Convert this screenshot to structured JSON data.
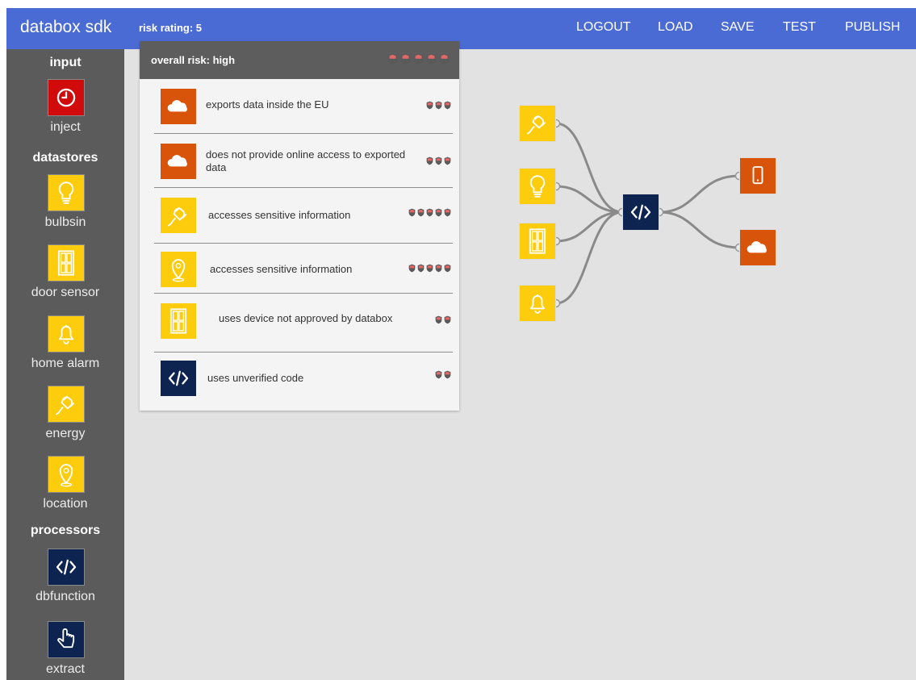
{
  "app": {
    "title": "databox sdk",
    "risk_rating": "risk rating: 5"
  },
  "nav": {
    "logout": "LOGOUT",
    "load": "LOAD",
    "save": "SAVE",
    "test": "TEST",
    "publish": "PUBLISH"
  },
  "colors": {
    "topbar": "#4b6bd4",
    "sidebar": "#5b5b5b",
    "canvas": "#e2e2e2",
    "yellow": "#fdcc0d",
    "orange": "#d9540b",
    "red": "#d10b0b",
    "navy": "#0d2451",
    "panel_header": "#5d5d5d"
  },
  "sidebar": {
    "sections": {
      "input": "input",
      "datastores": "datastores",
      "processors": "processors"
    },
    "tools": [
      {
        "label": "inject",
        "icon": "clock-icon"
      },
      {
        "label": "bulbsin",
        "icon": "bulb-icon"
      },
      {
        "label": "door sensor",
        "icon": "door-icon"
      },
      {
        "label": "home alarm",
        "icon": "bell-icon"
      },
      {
        "label": "energy",
        "icon": "plug-icon"
      },
      {
        "label": "location",
        "icon": "location-icon"
      },
      {
        "label": "dbfunction",
        "icon": "code-icon"
      },
      {
        "label": "extract",
        "icon": "pointer-hand-icon"
      }
    ]
  },
  "risk_panel": {
    "overall": "overall risk: high",
    "overall_shields": 5,
    "items": [
      {
        "text": "exports data inside the EU",
        "icon": "cloud-icon",
        "shields": 3
      },
      {
        "text": "does not provide online access to exported data",
        "icon": "cloud-icon",
        "shields": 3
      },
      {
        "text": "accesses sensitive information",
        "icon": "plug-icon",
        "shields": 5
      },
      {
        "text": "accesses sensitive information",
        "icon": "location-icon",
        "shields": 5
      },
      {
        "text": "uses  device not approved by databox",
        "icon": "door-icon",
        "shields": 2
      },
      {
        "text": "uses unverified code",
        "icon": "code-icon",
        "shields": 2
      }
    ]
  },
  "flow": {
    "inputs": [
      "plug-icon",
      "bulb-icon",
      "door-icon",
      "bell-icon"
    ],
    "processor": "code-icon",
    "outputs": [
      "phone-icon",
      "cloud-icon"
    ]
  }
}
